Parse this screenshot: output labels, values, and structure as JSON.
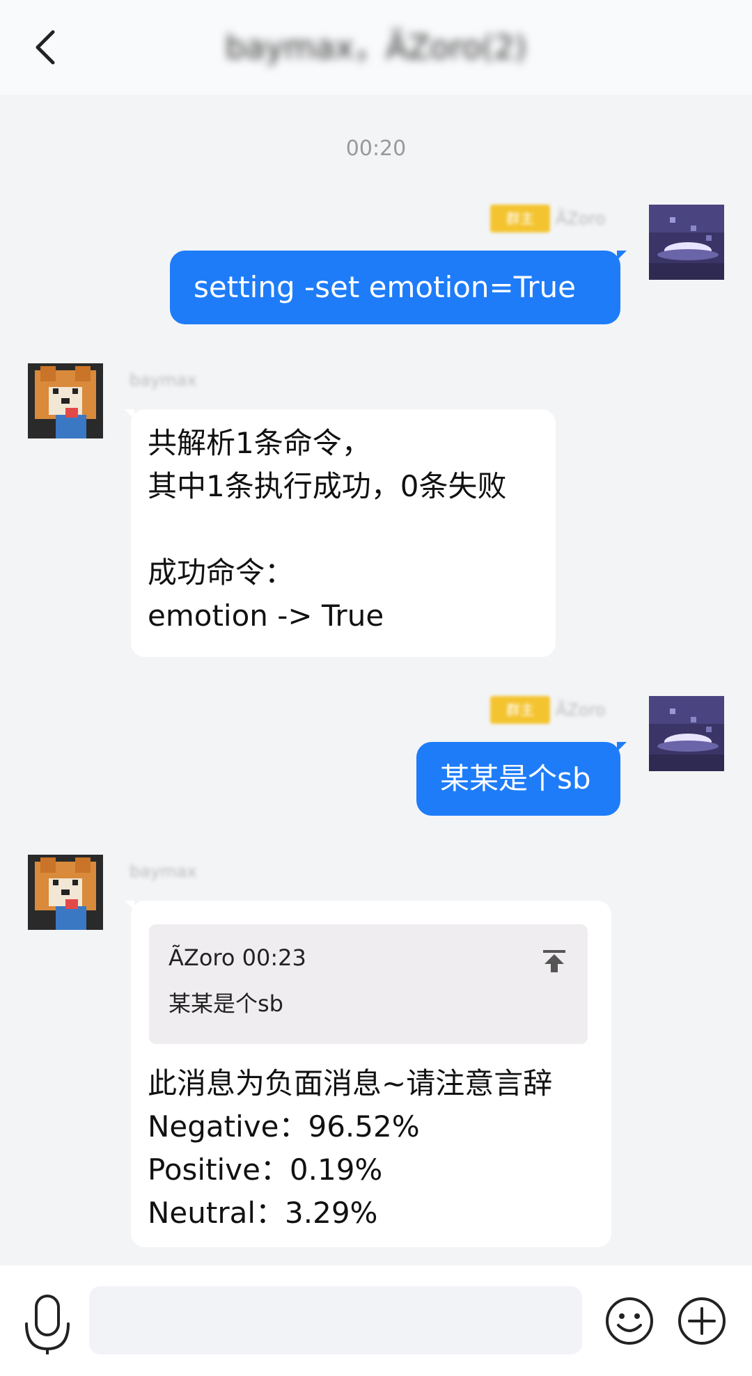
{
  "header": {
    "title": "baymax，ÃZoro(2)",
    "back_icon": "chevron-left-icon"
  },
  "chat": {
    "timestamp": "00:20",
    "messages": [
      {
        "direction": "outgoing",
        "sender": "ÃZoro",
        "badge": "群主",
        "text": "setting -set emotion=True"
      },
      {
        "direction": "incoming",
        "sender": "baymax",
        "lines": [
          "共解析1条命令，",
          "其中1条执行成功，0条失败",
          "",
          "成功命令：",
          "emotion -> True"
        ]
      },
      {
        "direction": "outgoing",
        "sender": "ÃZoro",
        "badge": "群主",
        "text": "某某是个sb"
      },
      {
        "direction": "incoming",
        "sender": "baymax",
        "quote": {
          "author_time": "ÃZoro 00:23",
          "text": "某某是个sb",
          "icon": "jump-to-top-icon"
        },
        "lines": [
          "此消息为负面消息~请注意言辞",
          "Negative：96.52%",
          "Positive：0.19%",
          "Neutral：3.29%"
        ]
      }
    ]
  },
  "input_bar": {
    "placeholder": "",
    "voice_icon": "microphone-icon",
    "emoji_icon": "smiley-icon",
    "plus_icon": "plus-circle-icon"
  },
  "colors": {
    "outgoing_bubble": "#1e7cf9",
    "incoming_bubble": "#ffffff",
    "background": "#f3f4f6",
    "badge": "#f4c430"
  }
}
